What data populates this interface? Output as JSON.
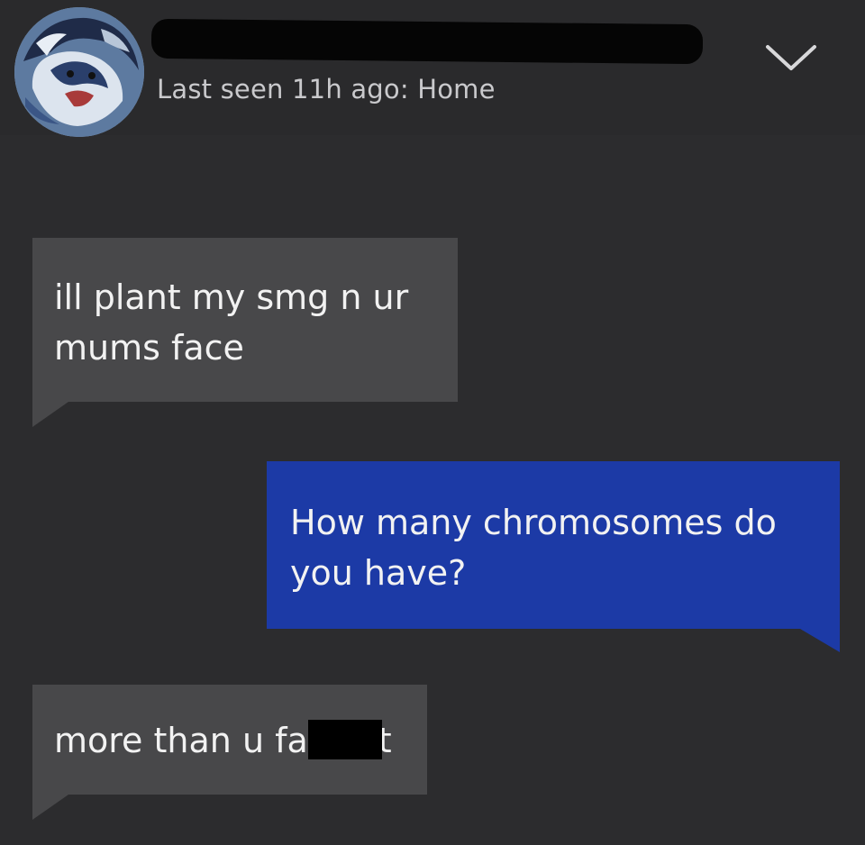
{
  "header": {
    "status_text": "Last seen 11h ago: Home",
    "avatar_icon": "lion-avatar-icon",
    "collapse_icon": "chevron-down-icon"
  },
  "messages": [
    {
      "direction": "incoming",
      "lines": [
        "ill plant my smg n ur",
        "mums face"
      ]
    },
    {
      "direction": "outgoing",
      "lines": [
        "How many chromosomes do",
        "you have?"
      ]
    },
    {
      "direction": "incoming",
      "text_before_redaction": "more than u fa",
      "text_after_redaction": "t"
    }
  ],
  "colors": {
    "background": "#2c2c2e",
    "incoming_bubble": "#48484a",
    "outgoing_bubble": "#1c3aa6",
    "text": "#f2f2f2",
    "status_text": "#c9c9cc"
  }
}
